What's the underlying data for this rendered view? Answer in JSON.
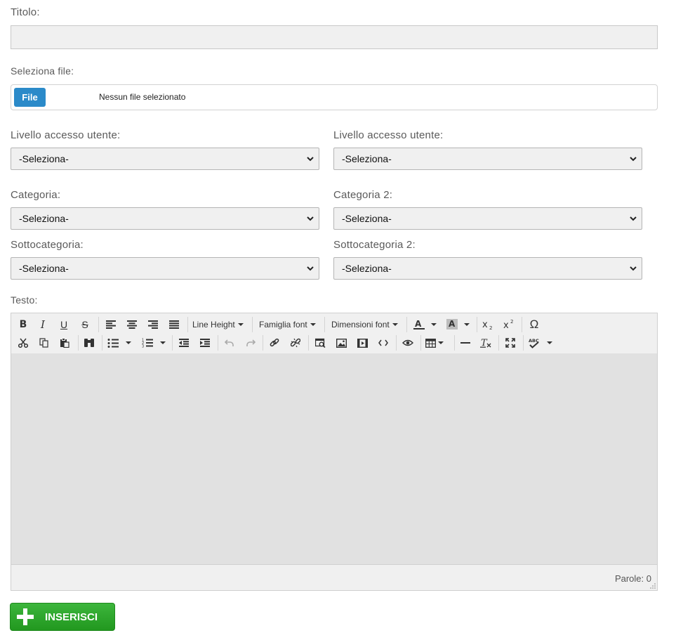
{
  "form": {
    "title_label": "Titolo:",
    "file_label": "Seleziona file:",
    "file_button": "File",
    "file_status": "Nessun file selezionato",
    "access_label_1": "Livello accesso utente:",
    "access_label_2": "Livello accesso utente:",
    "category_label_1": "Categoria:",
    "category_label_2": "Categoria 2:",
    "subcategory_label_1": "Sottocategoria:",
    "subcategory_label_2": "Sottocategoria 2:",
    "select_value": "-Seleziona-",
    "text_label": "Testo:"
  },
  "editor": {
    "line_height": "Line Height",
    "font_family": "Famiglia font",
    "font_size": "Dimensioni font",
    "word_count": "Parole: 0"
  },
  "submit": {
    "label": "INSERISCI"
  },
  "icons": [
    "bold-icon",
    "italic-icon",
    "underline-icon",
    "strikethrough-icon",
    "align-left-icon",
    "align-center-icon",
    "align-right-icon",
    "justify-icon",
    "text-color-icon",
    "background-color-icon",
    "subscript-icon",
    "superscript-icon",
    "special-char-icon",
    "cut-icon",
    "copy-icon",
    "paste-icon",
    "find-icon",
    "bullet-list-icon",
    "numbered-list-icon",
    "outdent-icon",
    "indent-icon",
    "undo-icon",
    "redo-icon",
    "link-icon",
    "unlink-icon",
    "image-search-icon",
    "image-icon",
    "media-icon",
    "code-icon",
    "preview-icon",
    "table-icon",
    "horizontal-rule-icon",
    "clear-format-icon",
    "fullscreen-icon",
    "spellcheck-icon"
  ],
  "colors": {
    "file_button": "#2b8ac9",
    "submit_button": "#2aa52a",
    "editor_area": "#e1e1e1"
  }
}
